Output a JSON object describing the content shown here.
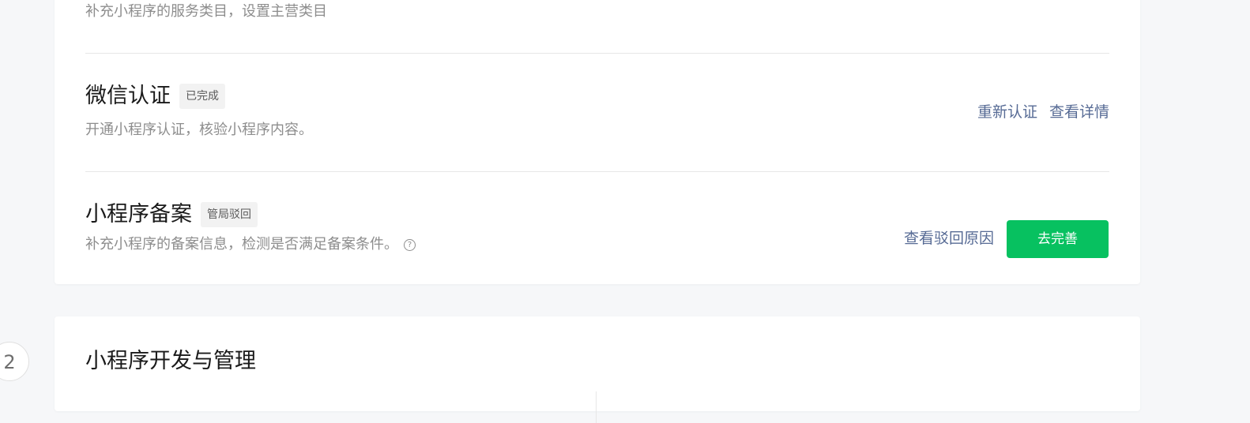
{
  "category_row": {
    "description": "补充小程序的服务类目，设置主营类目"
  },
  "wechat_verify": {
    "title": "微信认证",
    "badge": "已完成",
    "description": "开通小程序认证，核验小程序内容。",
    "reverify_link": "重新认证",
    "details_link": "查看详情"
  },
  "filing": {
    "title": "小程序备案",
    "badge": "管局驳回",
    "description": "补充小程序的备案信息，检测是否满足备案条件。",
    "help_icon": "?",
    "reject_reason_link": "查看驳回原因",
    "complete_button": "去完善"
  },
  "dev_section": {
    "step_number": "2",
    "title": "小程序开发与管理"
  },
  "colors": {
    "link": "#576b95",
    "primary": "#07c160",
    "page_bg": "#f6f7f9"
  }
}
